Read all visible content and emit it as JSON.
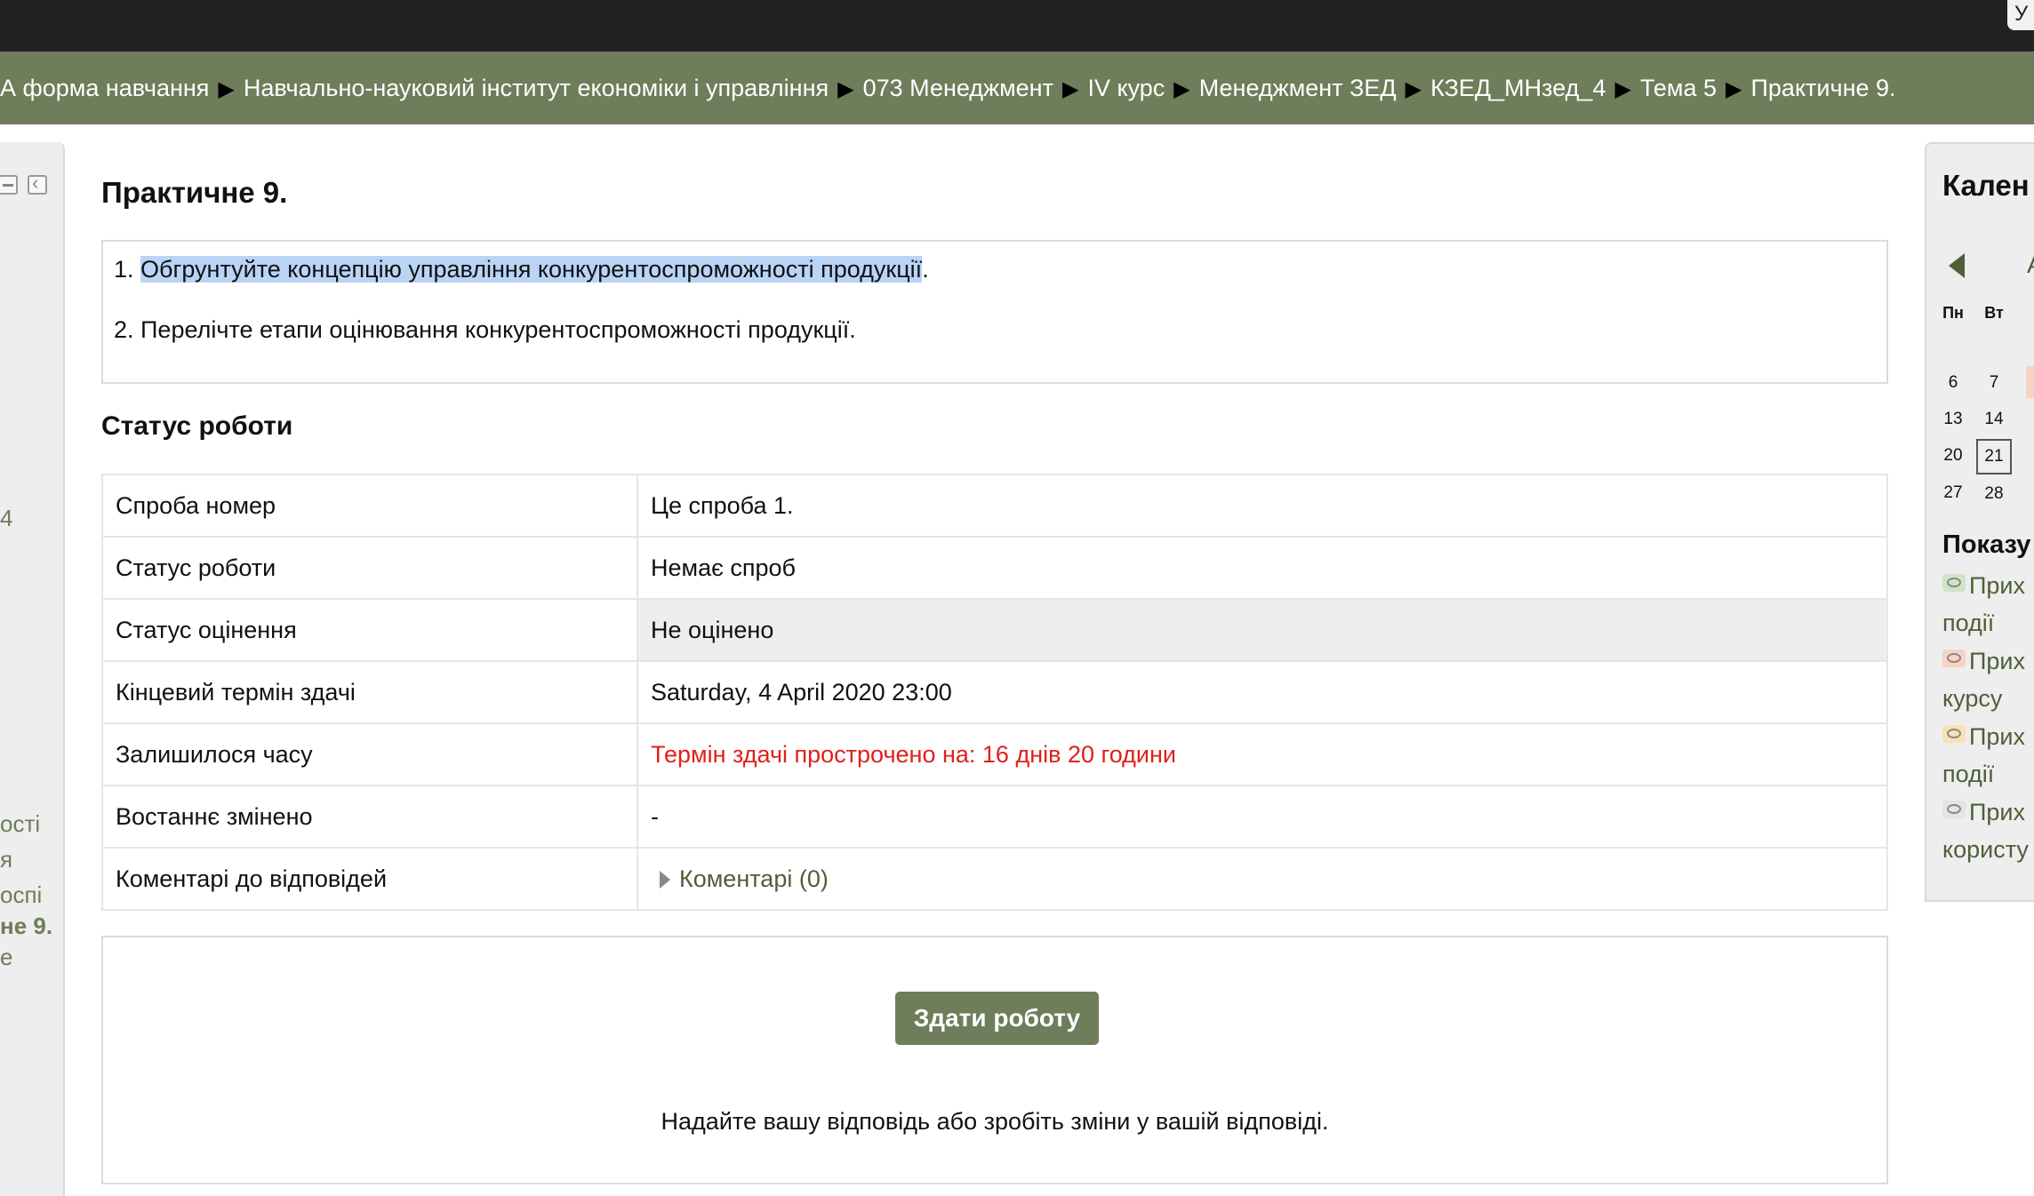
{
  "topbar": {
    "corner_label": "У"
  },
  "breadcrumb": {
    "items": [
      "А форма навчання",
      "Навчально-науковий інститут економіки і управління",
      "073 Менеджмент",
      "IV курс",
      "Менеджмент ЗЕД",
      "КЗЕД_МНзед_4",
      "Тема 5",
      "Практичне 9."
    ],
    "separator": "▶"
  },
  "left_block": {
    "fragments": [
      "4",
      "ості",
      "я",
      "оспі",
      "не 9.",
      "е"
    ]
  },
  "assignment": {
    "title": "Практичне 9.",
    "task1_number": "1. ",
    "task1_text": "Обгрунтуйте концепцію управління конкурентоспроможності продукції",
    "task1_end": ".",
    "task2": "2. Перелічте етапи оцінювання конкурентоспроможності продукції."
  },
  "status": {
    "heading": "Статус роботи",
    "rows": [
      {
        "label": "Спроба номер",
        "value": "Це спроба 1."
      },
      {
        "label": "Статус роботи",
        "value": "Немає спроб"
      },
      {
        "label": "Статус оцінення",
        "value": "Не оцінено"
      },
      {
        "label": "Кінцевий термін здачі",
        "value": "Saturday, 4 April 2020 23:00"
      },
      {
        "label": "Залишилося часу",
        "value": "Термін здачі прострочено на: 16 днів 20 години"
      },
      {
        "label": "Востаннє змінено",
        "value": "-"
      },
      {
        "label": "Коментарі до відповідей",
        "value": "Коментарі (0)"
      }
    ]
  },
  "submission": {
    "button_label": "Здати роботу",
    "hint": "Надайте вашу відповідь або зробіть зміни у вашій відповіді."
  },
  "calendar": {
    "title": "Кален",
    "month_fragment": "А",
    "weekdays": [
      "Пн",
      "Вт"
    ],
    "days": [
      "6",
      "7",
      "13",
      "14",
      "20",
      "21",
      "27",
      "28"
    ],
    "today": "21",
    "show_heading": "Показу",
    "events": [
      {
        "line1": "Прих",
        "line2": "події"
      },
      {
        "line1": "Прих",
        "line2": "курсу"
      },
      {
        "line1": "Прих",
        "line2": "події"
      },
      {
        "line1": "Прих",
        "line2": "користу"
      }
    ]
  },
  "colors": {
    "nav_green": "#6e7d5a",
    "link_green": "#4f5f3a",
    "overdue_red": "#e0201b",
    "selection_blue": "#b9d4f5",
    "event_site": "#cfe5c5",
    "event_course": "#f7d3c4",
    "event_group": "#f6e2b3",
    "event_user": "#e4e4e4"
  }
}
